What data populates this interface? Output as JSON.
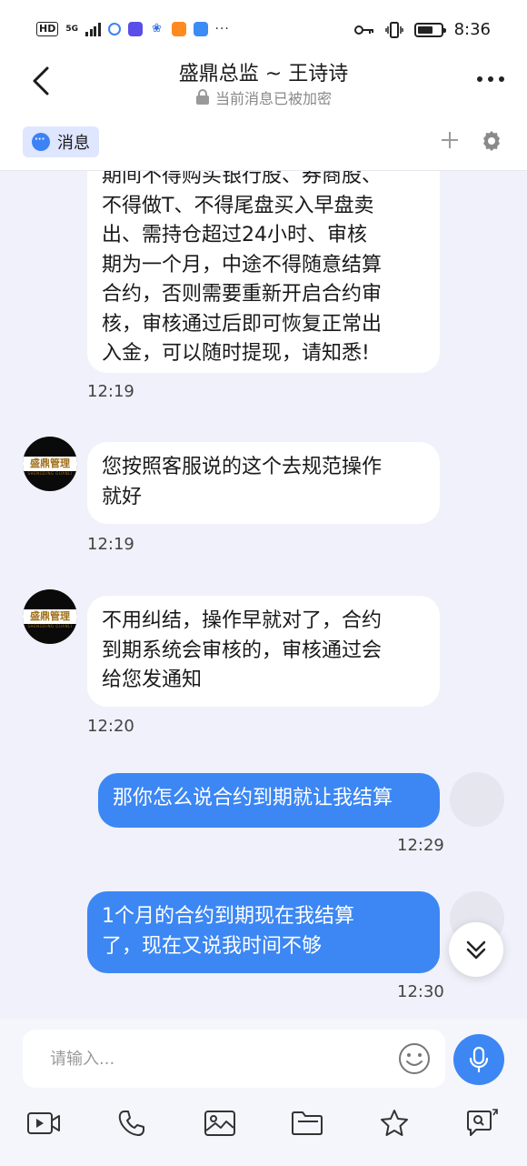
{
  "status_bar": {
    "hd": "HD",
    "network": "5G",
    "dots": "···",
    "time": "8:36"
  },
  "header": {
    "title": "盛鼎总监 ~ 王诗诗",
    "subtitle": "当前消息已被加密"
  },
  "tabs": {
    "message_label": "消息"
  },
  "messages": [
    {
      "sender": "other",
      "lines": [
        "期间不得购买银行股、券商股、",
        "不得做T、不得尾盘买入早盘卖",
        "出、需持仓超过24小时、审核",
        "期为一个月，中途不得随意结算",
        "合约，否则需要重新开启合约审",
        "核，审核通过后即可恢复正常出",
        "入金，可以随时提现，请知悉!"
      ],
      "time": "12:19"
    },
    {
      "sender": "other",
      "lines": [
        "您按照客服说的这个去规范操作",
        "就好"
      ],
      "time": "12:19"
    },
    {
      "sender": "other",
      "lines": [
        "不用纠结，操作早就对了，合约",
        "到期系统会审核的，审核通过会",
        "给您发通知"
      ],
      "time": "12:20"
    },
    {
      "sender": "me",
      "lines": [
        "那你怎么说合约到期就让我结算"
      ],
      "time": "12:29"
    },
    {
      "sender": "me",
      "lines": [
        "1个月的合约到期现在我结算",
        "了，现在又说我时间不够"
      ],
      "time": "12:30"
    }
  ],
  "avatar_logo": {
    "text": "盛鼎管理",
    "sub": "SHENGDING GUANLI"
  },
  "input": {
    "placeholder": "请输入..."
  },
  "colors": {
    "accent": "#3c87f4",
    "background": "#f0f1fa",
    "tab_highlight": "#dfe6ff"
  },
  "toolbar_icons": [
    "video-icon",
    "phone-icon",
    "image-icon",
    "folder-icon",
    "star-icon",
    "search-chat-icon"
  ]
}
